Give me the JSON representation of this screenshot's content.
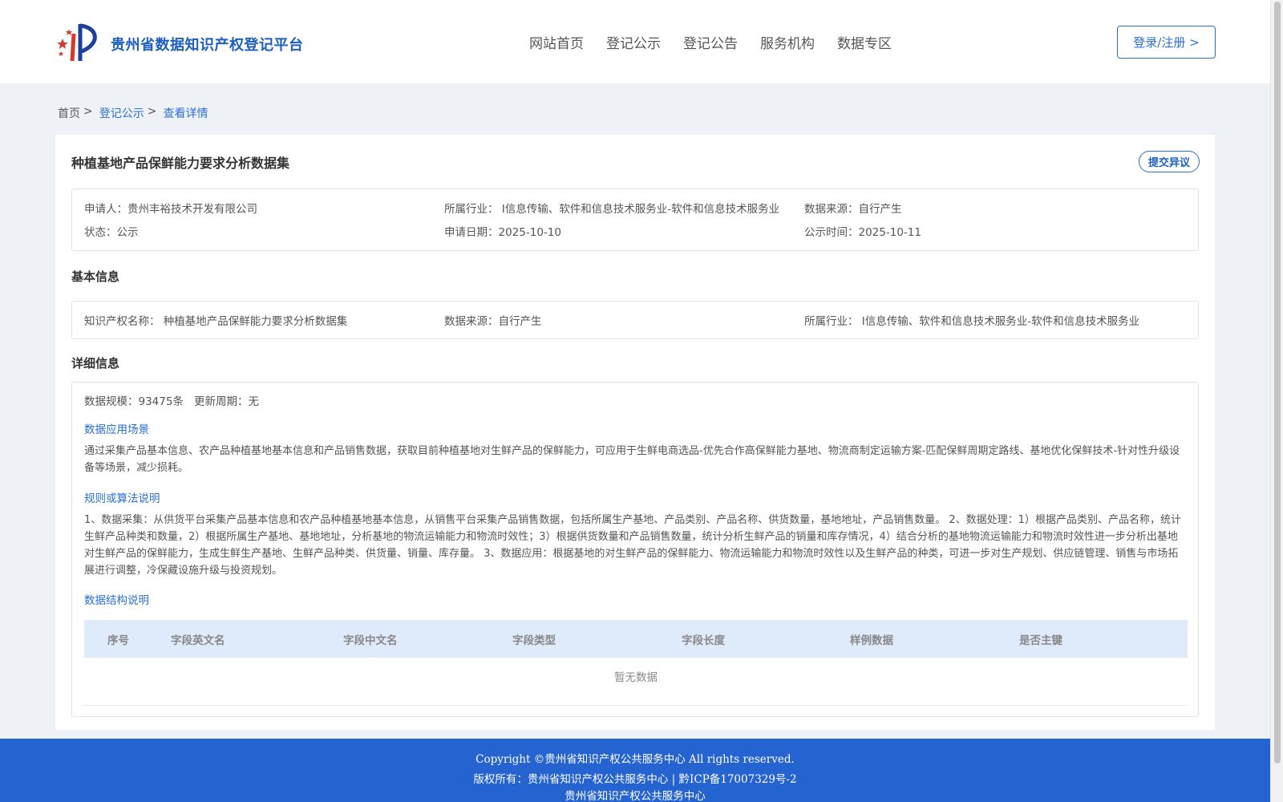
{
  "header": {
    "site_title": "贵州省数据知识产权登记平台",
    "nav": [
      "网站首页",
      "登记公示",
      "登记公告",
      "服务机构",
      "数据专区"
    ],
    "login_label": "登录/注册 >"
  },
  "breadcrumb": {
    "home": "首页",
    "level1": "登记公示",
    "current": "查看详情",
    "separator": ">"
  },
  "record": {
    "title": "种植基地产品保鲜能力要求分析数据集",
    "objection_label": "提交异议",
    "summary": {
      "applicant": "申请人：贵州丰裕技术开发有限公司",
      "industry": "所属行业： I信息传输、软件和信息技术服务业-软件和信息技术服务业",
      "source": "数据来源：自行产生",
      "status": "状态：公示",
      "apply_date": "申请日期：2025-10-10",
      "publish_date": "公示时间：2025-10-11"
    }
  },
  "basic": {
    "heading": "基本信息",
    "ip_name": "知识产权名称： 种植基地产品保鲜能力要求分析数据集",
    "source": "数据来源：自行产生",
    "industry": "所属行业： I信息传输、软件和信息技术服务业-软件和信息技术服务业"
  },
  "detail": {
    "heading": "详细信息",
    "scale": "数据规模：93475条",
    "cycle": "更新周期：无",
    "scenario_title": "数据应用场景",
    "scenario_text": "通过采集产品基本信息、农产品种植基地基本信息和产品销售数据，获取目前种植基地对生鲜产品的保鲜能力，可应用于生鲜电商选品-优先合作高保鲜能力基地、物流商制定运输方案-匹配保鲜周期定路线、基地优化保鲜技术-针对性升级设备等场景，减少损耗。",
    "rules_title": "规则或算法说明",
    "rules_text": "1、数据采集：从供货平台采集产品基本信息和农产品种植基地基本信息，从销售平台采集产品销售数据，包括所属生产基地、产品类别、产品名称、供货数量，基地地址，产品销售数量。 2、数据处理：1）根据产品类别、产品名称，统计生鲜产品种类和数量，2）根据所属生产基地、基地地址，分析基地的物流运输能力和物流时效性；3）根据供货数量和产品销售数量，统计分析生鲜产品的销量和库存情况，4）结合分析的基地物流运输能力和物流时效性进一步分析出基地对生鲜产品的保鲜能力，生成生鲜生产基地、生鲜产品种类、供货量、销量、库存量。 3、数据应用：根据基地的对生鲜产品的保鲜能力、物流运输能力和物流时效性以及生鲜产品的种类，可进一步对生产规划、供应链管理、销售与市场拓展进行调整，冷保藏设施升级与投资规划。",
    "structure_title": "数据结构说明",
    "table_headers": [
      "序号",
      "字段英文名",
      "字段中文名",
      "字段类型",
      "字段长度",
      "样例数据",
      "是否主键"
    ],
    "empty_text": "暂无数据"
  },
  "footer": {
    "copyright": "Copyright ©贵州省知识产权公共服务中心 All rights reserved.",
    "owner": "版权所有：贵州省知识产权公共服务中心 | 黔ICP备17007329号-2",
    "org": "贵州省知识产权公共服务中心"
  },
  "colors": {
    "accent": "#2a6fd6",
    "footer_bg": "#2563d0",
    "table_head_bg": "#dfeafb",
    "page_bg": "#eef2f6"
  }
}
